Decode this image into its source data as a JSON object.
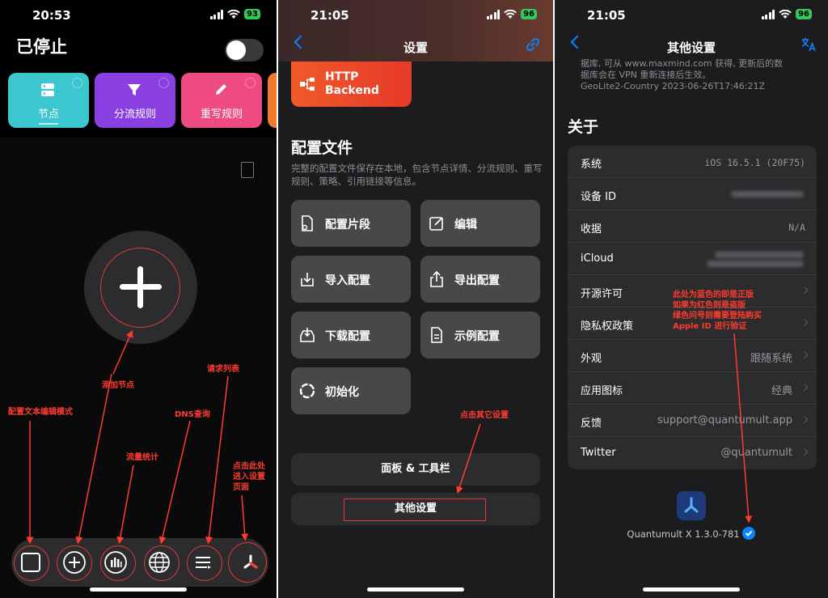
{
  "screen1": {
    "status": {
      "time": "20:53",
      "battery": "93"
    },
    "title": "已停止",
    "cards": [
      {
        "label": "节点",
        "color": "#3cc6cf"
      },
      {
        "label": "分流规则",
        "color": "#8a3fe0"
      },
      {
        "label": "重写规则",
        "color": "#ee4a83"
      }
    ],
    "annotations": {
      "add_node": "添加节点",
      "text_edit": "配置文本编辑模式",
      "traffic": "流量统计",
      "dns": "DNS查询",
      "requests": "请求列表",
      "settings_line1": "点击此处",
      "settings_line2": "进入设置",
      "settings_line3": "页面"
    }
  },
  "screen2": {
    "status": {
      "time": "21:05",
      "battery": "96"
    },
    "nav_title": "设置",
    "http_backend_line1": "HTTP",
    "http_backend_line2": "Backend",
    "section_title": "配置文件",
    "section_desc": "完整的配置文件保存在本地，包含节点详情、分流规则、重写规则、策略、引用链接等信息。",
    "tiles": {
      "snippet": "配置片段",
      "edit": "编辑",
      "import": "导入配置",
      "export": "导出配置",
      "download": "下载配置",
      "example": "示例配置",
      "reset": "初始化"
    },
    "panel_toolbar": "面板 & 工具栏",
    "other_settings": "其他设置",
    "annotation": "点击其它设置"
  },
  "screen3": {
    "status": {
      "time": "21:05",
      "battery": "96"
    },
    "nav_title": "其他设置",
    "geo_line1": "据库, 可从 www.maxmind.com 获得, 更新后的数",
    "geo_line2": "据库会在 VPN 重新连接后生效。",
    "geo_line3": "GeoLite2-Country 2023-06-26T17:46:21Z",
    "section_title": "关于",
    "rows": [
      {
        "key": "系统",
        "value": "iOS 16.5.1 (20F75)"
      },
      {
        "key": "设备 ID",
        "value": ""
      },
      {
        "key": "收据",
        "value": "N/A"
      },
      {
        "key": "iCloud",
        "value": ""
      },
      {
        "key": "开源许可",
        "value": ""
      },
      {
        "key": "隐私权政策",
        "value": ""
      },
      {
        "key": "外观",
        "value": "跟随系统"
      },
      {
        "key": "应用图标",
        "value": "经典"
      },
      {
        "key": "反馈",
        "value": "support@quantumult.app"
      },
      {
        "key": "Twitter",
        "value": "@quantumult"
      }
    ],
    "version": "Quantumult X 1.3.0-781",
    "annotation_line1": "此处为蓝色的即是正版",
    "annotation_line2": "如果为红色则是盗版",
    "annotation_line3": "绿色问号则需要登陆购买",
    "annotation_line4": "Apple ID 进行验证"
  }
}
